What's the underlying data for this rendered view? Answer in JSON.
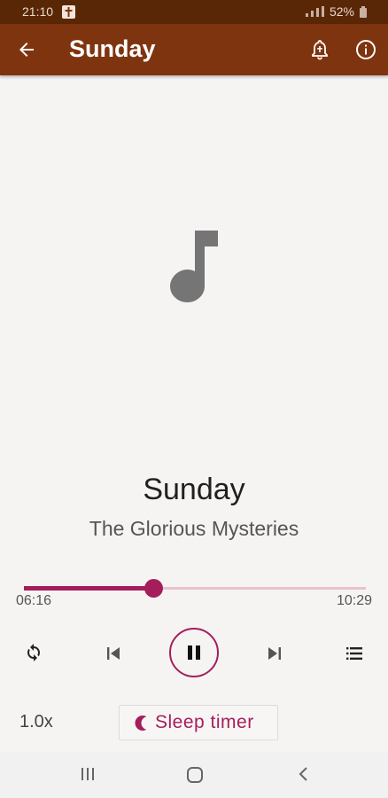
{
  "status_bar": {
    "time": "21:10",
    "battery": "52%"
  },
  "app_bar": {
    "title": "Sunday",
    "icons": [
      "back-arrow-icon",
      "bell-icon",
      "info-icon"
    ]
  },
  "track": {
    "title": "Sunday",
    "subtitle": "The Glorious Mysteries"
  },
  "player": {
    "elapsed": "06:16",
    "duration": "10:29",
    "progress": 0.377,
    "speed": "1.0x",
    "sleep_timer_label": "Sleep timer",
    "state": "playing"
  },
  "colors": {
    "status_bar": "#5a2706",
    "app_bar": "#7f3410",
    "accent": "#a51e5b",
    "background": "#f5f4f3"
  }
}
